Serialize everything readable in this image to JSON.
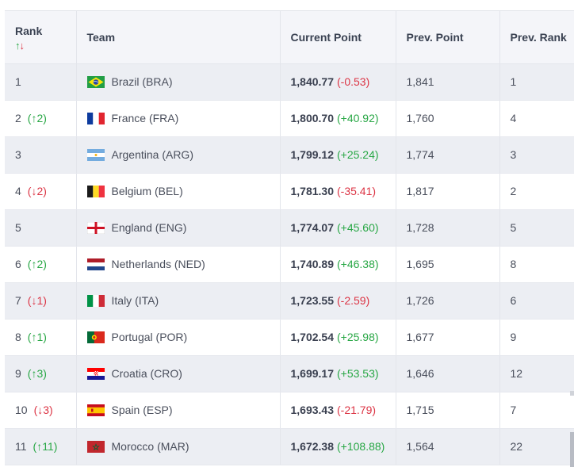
{
  "columns": {
    "rank": "Rank",
    "rank_sort": {
      "up": "↑",
      "down": "↓"
    },
    "team": "Team",
    "current": "Current Point",
    "prev_point": "Prev. Point",
    "prev_rank": "Prev. Rank"
  },
  "rows": [
    {
      "rank": "1",
      "rank_change": "",
      "dir": "",
      "flag": "BRA",
      "team": "Brazil (BRA)",
      "points": "1,840.77",
      "delta": "(-0.53)",
      "prev_point": "1,841",
      "prev_rank": "1"
    },
    {
      "rank": "2",
      "rank_change": "(↑2)",
      "dir": "up",
      "flag": "FRA",
      "team": "France (FRA)",
      "points": "1,800.70",
      "delta": "(+40.92)",
      "prev_point": "1,760",
      "prev_rank": "4"
    },
    {
      "rank": "3",
      "rank_change": "",
      "dir": "",
      "flag": "ARG",
      "team": "Argentina (ARG)",
      "points": "1,799.12",
      "delta": "(+25.24)",
      "prev_point": "1,774",
      "prev_rank": "3"
    },
    {
      "rank": "4",
      "rank_change": "(↓2)",
      "dir": "down",
      "flag": "BEL",
      "team": "Belgium (BEL)",
      "points": "1,781.30",
      "delta": "(-35.41)",
      "prev_point": "1,817",
      "prev_rank": "2"
    },
    {
      "rank": "5",
      "rank_change": "",
      "dir": "",
      "flag": "ENG",
      "team": "England (ENG)",
      "points": "1,774.07",
      "delta": "(+45.60)",
      "prev_point": "1,728",
      "prev_rank": "5"
    },
    {
      "rank": "6",
      "rank_change": "(↑2)",
      "dir": "up",
      "flag": "NED",
      "team": "Netherlands (NED)",
      "points": "1,740.89",
      "delta": "(+46.38)",
      "prev_point": "1,695",
      "prev_rank": "8"
    },
    {
      "rank": "7",
      "rank_change": "(↓1)",
      "dir": "down",
      "flag": "ITA",
      "team": "Italy (ITA)",
      "points": "1,723.55",
      "delta": "(-2.59)",
      "prev_point": "1,726",
      "prev_rank": "6"
    },
    {
      "rank": "8",
      "rank_change": "(↑1)",
      "dir": "up",
      "flag": "POR",
      "team": "Portugal (POR)",
      "points": "1,702.54",
      "delta": "(+25.98)",
      "prev_point": "1,677",
      "prev_rank": "9"
    },
    {
      "rank": "9",
      "rank_change": "(↑3)",
      "dir": "up",
      "flag": "CRO",
      "team": "Croatia (CRO)",
      "points": "1,699.17",
      "delta": "(+53.53)",
      "prev_point": "1,646",
      "prev_rank": "12"
    },
    {
      "rank": "10",
      "rank_change": "(↓3)",
      "dir": "down",
      "flag": "ESP",
      "team": "Spain (ESP)",
      "points": "1,693.43",
      "delta": "(-21.79)",
      "prev_point": "1,715",
      "prev_rank": "7"
    },
    {
      "rank": "11",
      "rank_change": "(↑11)",
      "dir": "up",
      "flag": "MAR",
      "team": "Morocco (MAR)",
      "points": "1,672.38",
      "delta": "(+108.88)",
      "prev_point": "1,564",
      "prev_rank": "22"
    }
  ],
  "colors": {
    "up": "#28a745",
    "down": "#dc3545",
    "header_bg": "#f4f5f9",
    "row_alt": "#eceef3"
  }
}
